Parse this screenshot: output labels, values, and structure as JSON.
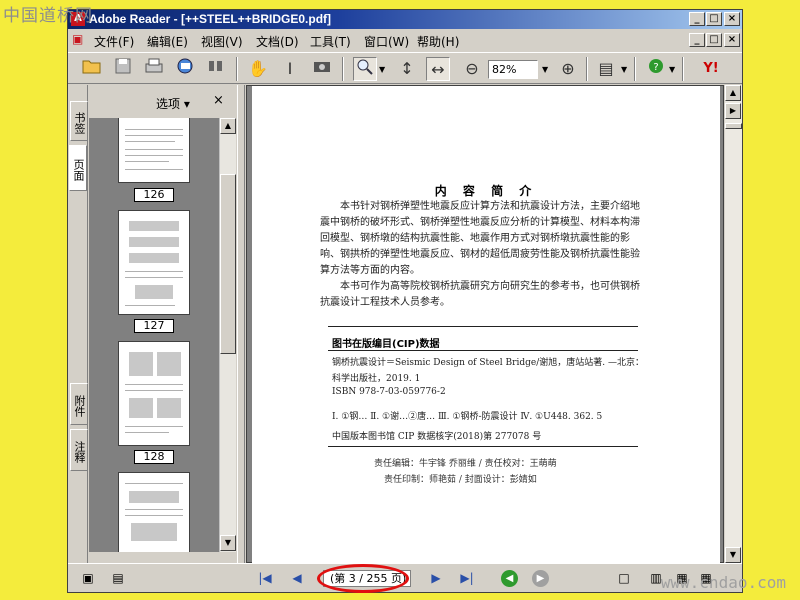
{
  "watermarks": {
    "top_left": "中国道桥网",
    "bottom_right": "www.cndao.com"
  },
  "window": {
    "title": "Adobe Reader - [++STEEL++BRIDGE0.pdf]",
    "controls": {
      "minimize": "_",
      "maximize": "□",
      "close": "×"
    }
  },
  "menu": {
    "items": [
      "文件(F)",
      "编辑(E)",
      "视图(V)",
      "文档(D)",
      "工具(T)",
      "窗口(W)",
      "帮助(H)"
    ]
  },
  "toolbar": {
    "zoom_value": "82%",
    "icons": [
      "open-icon",
      "save-icon",
      "print-icon",
      "email-icon",
      "search-icon",
      "hand-icon",
      "select-text-icon",
      "snapshot-icon",
      "zoom-in-tool-icon",
      "fit-page-icon",
      "fit-width-icon",
      "zoom-out-icon",
      "zoom-in-icon",
      "document-options-icon",
      "help-icon",
      "yahoo-icon"
    ],
    "yahoo_label": "Y!"
  },
  "nav_tabs": {
    "bookmarks": "书签",
    "pages": "页面",
    "attachments": "附件",
    "comments": "注释"
  },
  "pages_panel": {
    "options_label": "选项 ▾",
    "close_label": "×",
    "thumbnails": [
      {
        "page_label": "126"
      },
      {
        "page_label": "127"
      },
      {
        "page_label": "128"
      },
      {
        "page_label": ""
      }
    ]
  },
  "document": {
    "heading": "内 容 简 介",
    "paragraph1": "本书针对钢桥弹塑性地震反应计算方法和抗震设计方法，主要介绍地震中钢桥的破坏形式、钢桥弹塑性地震反应分析的计算模型、材料本构滞回模型、钢桥墩的结构抗震性能、地震作用方式对钢桥墩抗震性能的影响、钢拱桥的弹塑性地震反应、钢材的超低周疲劳性能及钢桥抗震性能验算方法等方面的内容。",
    "paragraph2": "本书可作为高等院校钢桥抗震研究方向研究生的参考书，也可供钢桥抗震设计工程技术人员参考。",
    "cip_title": "图书在版编目(CIP)数据",
    "cip_line1": "钢桥抗震设计＝Seismic Design of Steel Bridge/谢旭，唐站站著. —北京：",
    "cip_line2": "科学出版社，2019. 1",
    "cip_isbn": "ISBN 978-7-03-059776-2",
    "cip_class": "Ⅰ. ①钢…  Ⅱ. ①谢…②唐…  Ⅲ. ①钢桥-防震设计  Ⅳ. ①U448. 362. 5",
    "cip_number": "中国版本图书馆 CIP 数据核字(2018)第 277078 号",
    "credit1": "责任编辑：牛宇锋  乔丽维 / 责任校对：王萌萌",
    "credit2": "责任印制：师艳茹 / 封面设计：彭婧如"
  },
  "statusbar": {
    "page_field": "(第 3 / 255 页)",
    "first": "|◀",
    "prev": "◀",
    "next": "▶",
    "last": "▶|",
    "back": "◀",
    "forward": "▶"
  },
  "colors": {
    "background": "#f4ec3c",
    "titlebar": "#0a246a",
    "highlight_circle": "#e01010"
  }
}
